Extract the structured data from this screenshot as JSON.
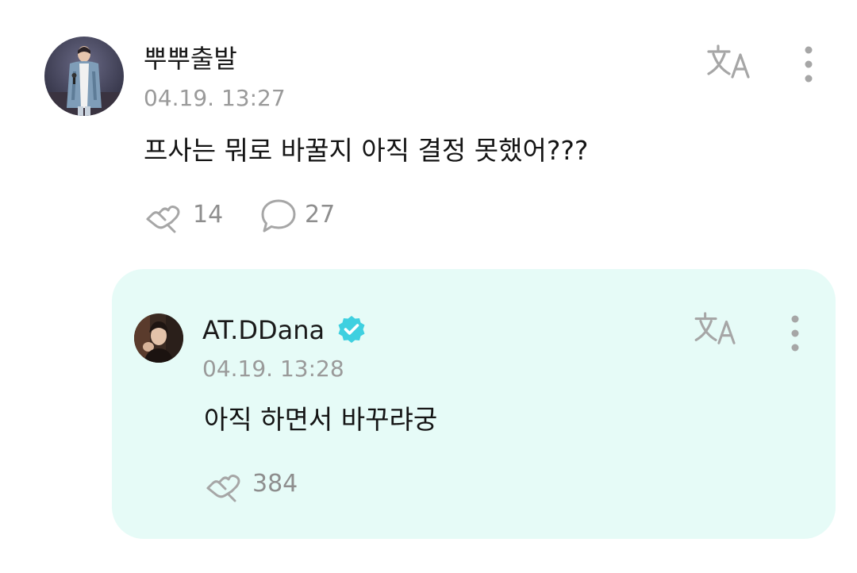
{
  "comment": {
    "username": "뿌뿌출발",
    "timestamp": "04.19. 13:27",
    "text": "프사는 뭐로 바꿀지 아직 결정 못했어???",
    "like_count": "14",
    "reply_count": "27",
    "icons": {
      "translate": "translate-icon",
      "more": "more-vertical-icon",
      "like": "heart-hand-icon",
      "reply": "speech-bubble-icon"
    }
  },
  "reply": {
    "username": "AT.DDana",
    "verified": true,
    "timestamp": "04.19. 13:28",
    "text": "아직 하면서 바꾸랴궁",
    "like_count": "384",
    "icons": {
      "translate": "translate-icon",
      "more": "more-vertical-icon",
      "like": "heart-hand-icon",
      "verified": "verified-badge-icon"
    }
  },
  "colors": {
    "reply_background": "#e6fbf7",
    "verified_badge": "#3fd0e0",
    "icon_gray": "#a6a6a6",
    "muted_text": "#9a9a9a"
  }
}
